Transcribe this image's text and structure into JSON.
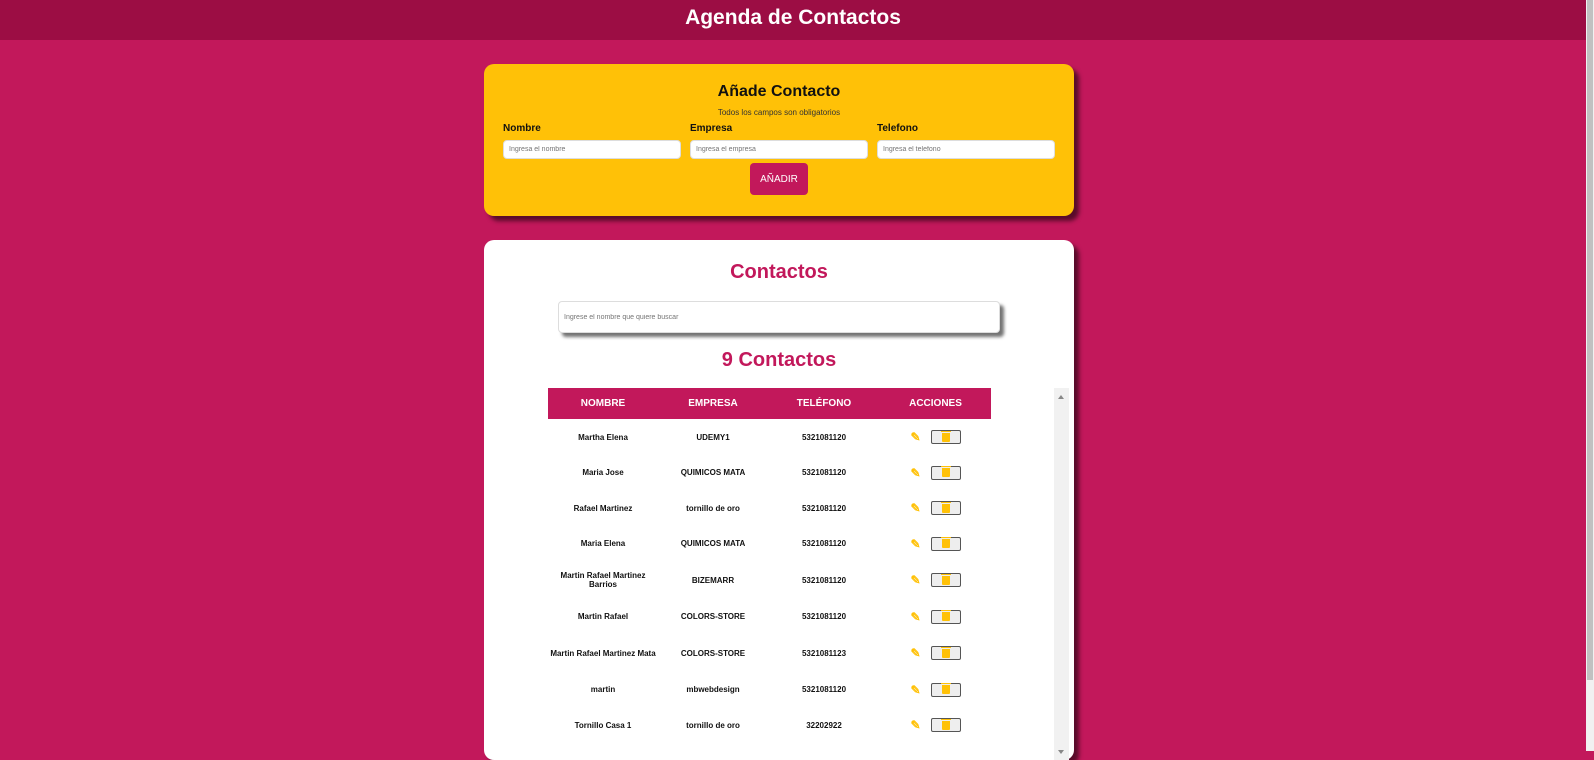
{
  "header": {
    "title": "Agenda de Contactos"
  },
  "add_form": {
    "title": "Añade Contacto",
    "subtitle": "Todos los campos son obligatorios",
    "fields": [
      {
        "label": "Nombre",
        "placeholder": "Ingresa el nombre",
        "value": ""
      },
      {
        "label": "Empresa",
        "placeholder": "Ingresa el empresa",
        "value": ""
      },
      {
        "label": "Telefono",
        "placeholder": "Ingresa el telefono",
        "value": ""
      }
    ],
    "submit_label": "AÑADIR"
  },
  "contacts": {
    "title": "Contactos",
    "search_placeholder": "Ingrese el nombre que quiere buscar",
    "count_label": "9 Contactos",
    "columns": [
      "NOMBRE",
      "EMPRESA",
      "TELÉFONO",
      "ACCIONES"
    ],
    "rows": [
      {
        "nombre": "Martha Elena",
        "empresa": "UDEMY1",
        "telefono": "5321081120"
      },
      {
        "nombre": "Maria Jose",
        "empresa": "QUIMICOS MATA",
        "telefono": "5321081120"
      },
      {
        "nombre": "Rafael Martinez",
        "empresa": "tornillo de oro",
        "telefono": "5321081120"
      },
      {
        "nombre": "Maria Elena",
        "empresa": "QUIMICOS MATA",
        "telefono": "5321081120"
      },
      {
        "nombre": "Martin Rafael Martinez Barrios",
        "empresa": "BIZEMARR",
        "telefono": "5321081120"
      },
      {
        "nombre": "Martin Rafael",
        "empresa": "COLORS-STORE",
        "telefono": "5321081120"
      },
      {
        "nombre": "Martin Rafael Martinez Mata",
        "empresa": "COLORS-STORE",
        "telefono": "5321081123"
      },
      {
        "nombre": "martin",
        "empresa": "mbwebdesign",
        "telefono": "5321081120"
      },
      {
        "nombre": "Tornillo Casa 1",
        "empresa": "tornillo de oro",
        "telefono": "32202922"
      }
    ]
  },
  "colors": {
    "primary": "#c2185b",
    "header": "#9c0d44",
    "accent": "#ffc107"
  },
  "icons": {
    "edit": "edit-icon",
    "delete": "trash-icon"
  }
}
